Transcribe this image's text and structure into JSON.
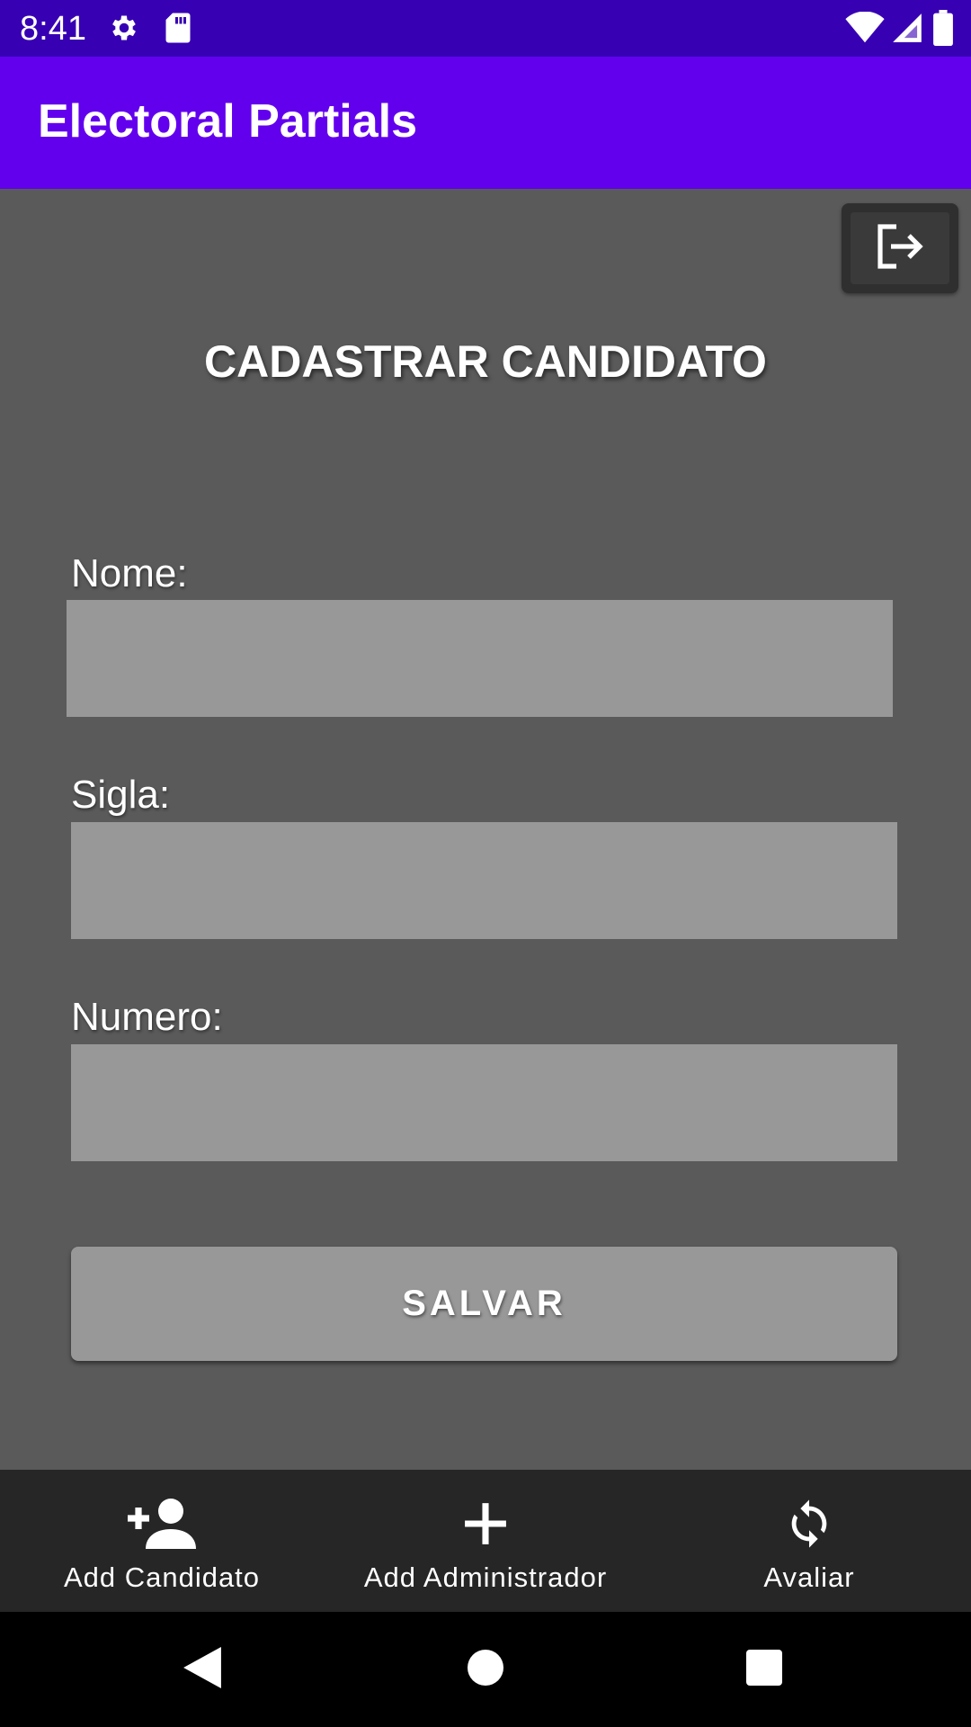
{
  "status_bar": {
    "time": "8:41"
  },
  "app_bar": {
    "title": "Electoral Partials"
  },
  "page": {
    "title": "CADASTRAR CANDIDATO"
  },
  "form": {
    "nome_label": "Nome:",
    "nome_value": "",
    "sigla_label": "Sigla:",
    "sigla_value": "",
    "numero_label": "Numero:",
    "numero_value": "",
    "save_label": "SALVAR"
  },
  "bottom_nav": {
    "items": [
      {
        "label": "Add Candidato",
        "icon": "person-add-icon"
      },
      {
        "label": "Add Administrador",
        "icon": "plus-icon"
      },
      {
        "label": "Avaliar",
        "icon": "sync-icon"
      }
    ]
  },
  "colors": {
    "status_bar": "#3700b3",
    "app_bar": "#6200ee",
    "background": "#5a5a5a",
    "input": "#989898",
    "bottom_nav": "#262626"
  }
}
